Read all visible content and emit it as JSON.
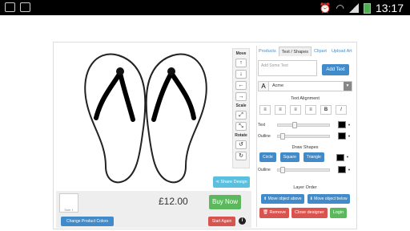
{
  "status_bar": {
    "time": "13:17"
  },
  "tools": {
    "move_label": "Move",
    "up": "↑",
    "down": "↓",
    "left": "←",
    "right": "→",
    "scale_label": "Scale",
    "scale_up": "⤢",
    "scale_down": "⤡",
    "rotate_label": "Rotate",
    "rotate_left": "↺",
    "rotate_right": "↻"
  },
  "share_label": "Share Design",
  "product": {
    "price": "£12.00",
    "thumb_caption": "Sole 1"
  },
  "buttons": {
    "buy_now": "Buy Now",
    "change_colors": "Change Product Colors",
    "start_again": "Start Again",
    "info": "i"
  },
  "tabs": [
    "Products",
    "Text / Shapes",
    "Clipart",
    "Upload Art"
  ],
  "text_panel": {
    "input_placeholder": "Add Some Text",
    "add_text": "Add Text",
    "font_glyph": "A",
    "font_value": "Acme",
    "text_alignment": "Text Alignment",
    "align_buttons": [
      "≡",
      "≡",
      "≡",
      "≡",
      "B",
      "I"
    ],
    "text_label": "Text",
    "outline_label": "Outline",
    "text_slider": 0.3,
    "outline_slider": 0.05
  },
  "shapes_panel": {
    "title": "Draw Shapes",
    "shapes": [
      "Circle",
      "Square",
      "Triangle"
    ],
    "outline_label": "Outline",
    "outline_slider": 0.05
  },
  "layer_panel": {
    "title": "Layer Order",
    "move_above": "Move object above",
    "move_below": "Move object below"
  },
  "actions": {
    "remove": "Remove",
    "close": "Close designer",
    "login": "Login"
  },
  "colors": {
    "primary": "#428bca",
    "success": "#5cb85c",
    "danger": "#d9534f",
    "info": "#5bc0de"
  }
}
